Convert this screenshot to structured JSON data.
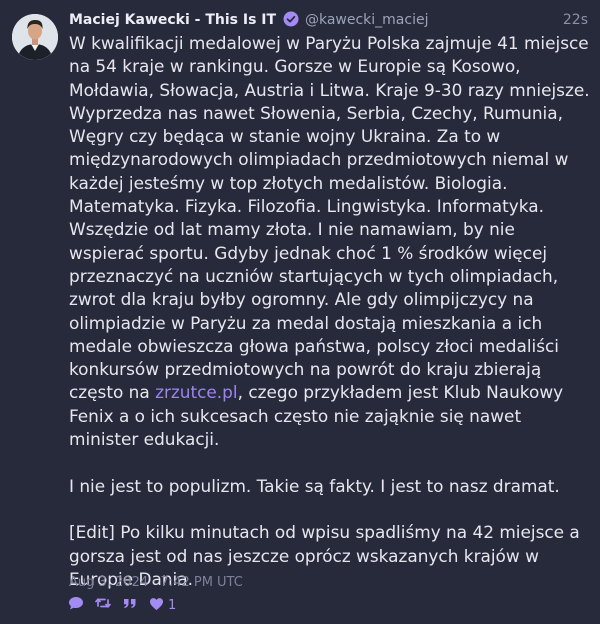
{
  "post": {
    "author_name": "Maciej Kawecki - This Is IT",
    "handle": "@kawecki_maciej",
    "time_ago": "22s",
    "body_part1": "W kwalifikacji medalowej w Paryżu Polska zajmuje 41 miejsce na 54 kraje w rankingu. Gorsze w Europie są Kosowo, Mołdawia, Słowacja, Austria i Litwa. Kraje 9-30 razy mniejsze. Wyprzedza nas nawet Słowenia, Serbia, Czechy, Rumunia, Węgry czy będąca w stanie wojny Ukraina. Za to w międzynarodowych olimpiadach przedmiotowych niemal w każdej jesteśmy w top złotych medalistów. Biologia. Matematyka. Fizyka. Filozofia. Lingwistyka. Informatyka. Wszędzie od lat mamy złota. I nie namawiam, by nie wspierać sportu. Gdyby jednak choć 1 % środków więcej przeznaczyć na uczniów startujących w tych olimpiadach, zwrot dla kraju byłby ogromny. Ale gdy olimpijczycy na olimpiadzie w Paryżu za medal dostają mieszkania a ich medale obwieszcza głowa państwa, polscy złoci medaliści konkursów przedmiotowych na powrót do kraju zbierają często na ",
    "link_text": "zrzutce.pl",
    "body_part2": ", czego przykładem jest Klub Naukowy Fenix a o ich sukcesach często nie zająknie się nawet minister edukacji.",
    "paragraph2": "I nie jest to populizm. Takie są fakty. I jest to nasz dramat.",
    "paragraph3": "[Edit] Po kilku minutach od wpisu spadliśmy na 42 miejsce a gorsza jest od nas jeszcze oprócz wskazanych krajów w Europie Dania.",
    "timestamp": "Aug 3, 2024 · 7:42 PM UTC",
    "like_count": "1"
  },
  "icons": {
    "reply": "speech-bubble-icon",
    "repost": "repost-icon",
    "quote": "quote-icon",
    "like": "heart-icon",
    "verified": "verified-badge-icon"
  },
  "colors": {
    "background": "#272a3b",
    "accent": "#a48af3",
    "link": "#9d84f0",
    "text": "#e6e7ee",
    "muted": "#7d8199"
  }
}
